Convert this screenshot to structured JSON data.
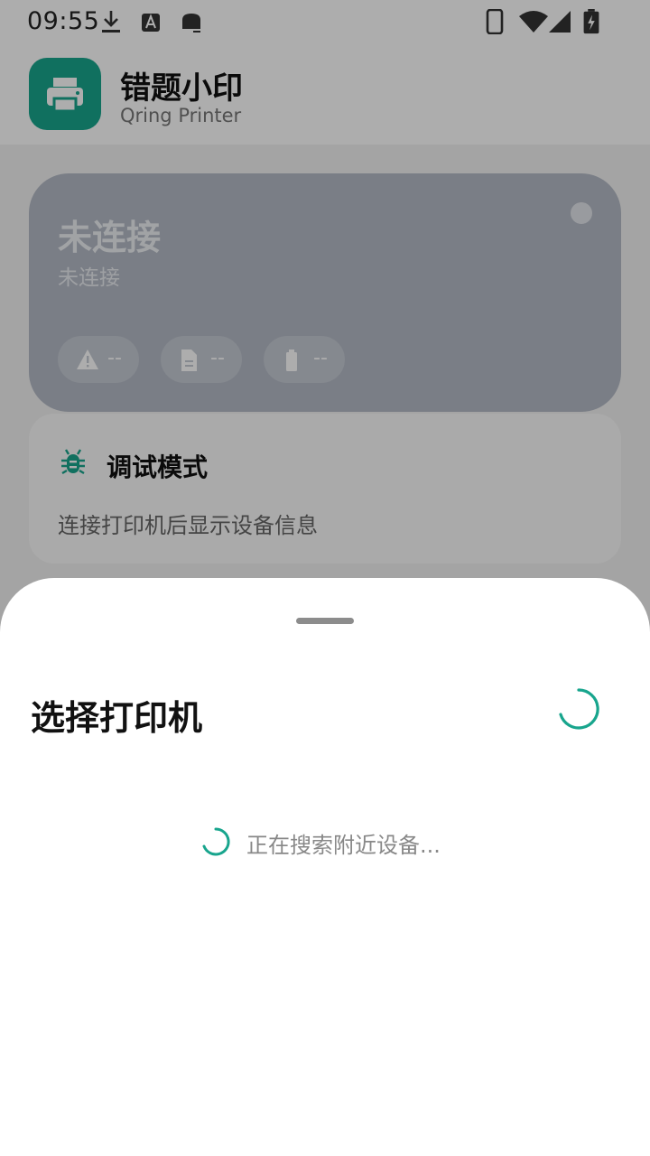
{
  "status_bar": {
    "time": "09:55",
    "icons": [
      "download-icon",
      "font-icon",
      "app-icon",
      "phone-icon",
      "wifi-icon",
      "signal-icon",
      "battery-charging-icon"
    ]
  },
  "app": {
    "title": "错题小印",
    "subtitle": "Qring Printer",
    "logo_icon": "printer-icon",
    "accent_color": "#18a58d"
  },
  "status_card": {
    "title": "未连接",
    "subtitle": "未连接",
    "chips": [
      {
        "icon": "warning-icon",
        "value": "--"
      },
      {
        "icon": "document-icon",
        "value": "--"
      },
      {
        "icon": "battery-icon",
        "value": "--"
      }
    ]
  },
  "debug_card": {
    "icon": "bug-icon",
    "title": "调试模式",
    "description": "连接打印机后显示设备信息"
  },
  "sheet": {
    "title": "选择打印机",
    "searching_text": "正在搜索附近设备..."
  }
}
